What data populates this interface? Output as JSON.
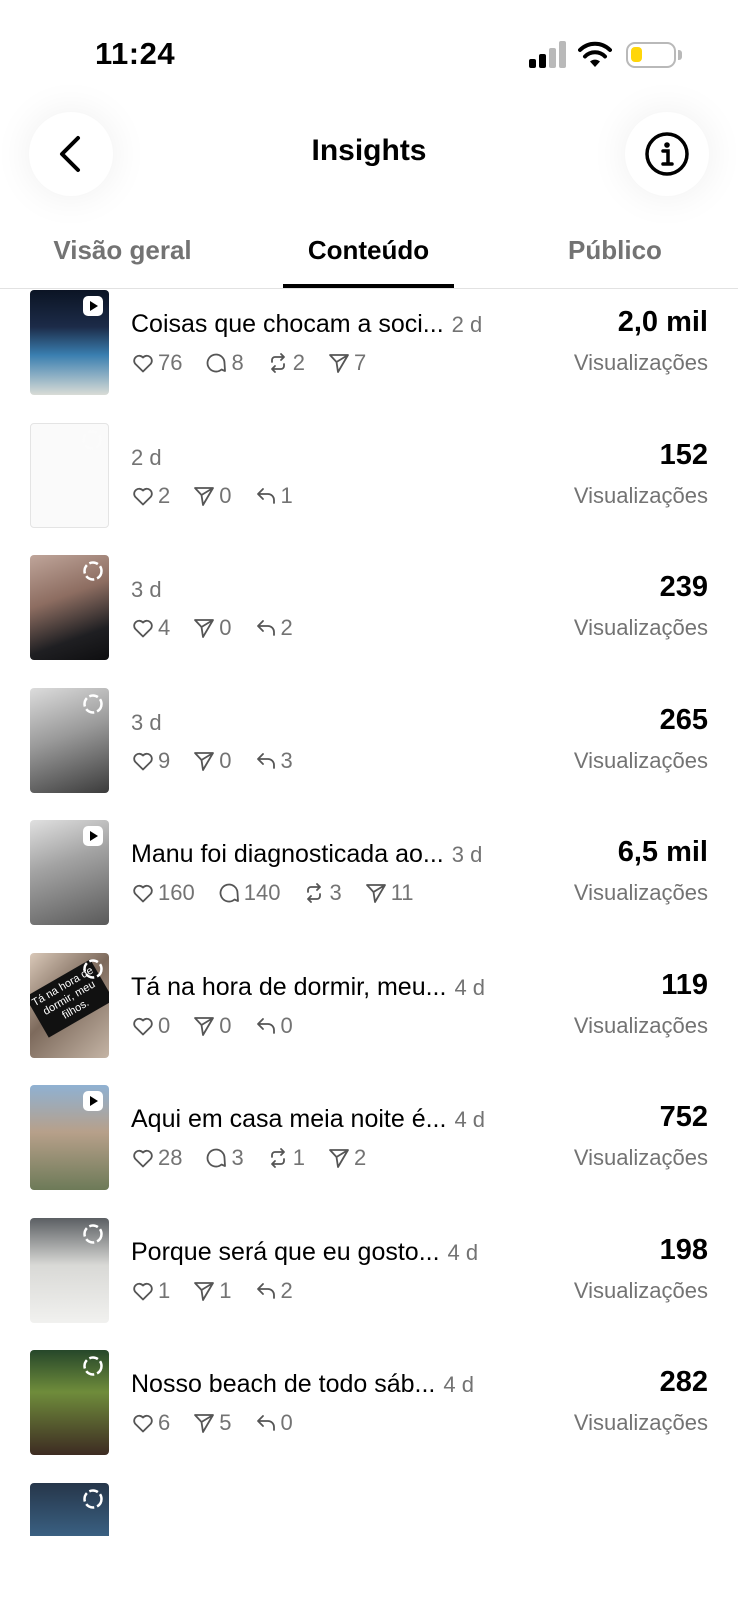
{
  "status": {
    "time": "11:24"
  },
  "header": {
    "title": "Insights"
  },
  "tabs": [
    {
      "label": "Visão geral",
      "active": false
    },
    {
      "label": "Conteúdo",
      "active": true
    },
    {
      "label": "Público",
      "active": false
    }
  ],
  "rows": [
    {
      "caption": "Coisas que chocam a soci...",
      "age": "2 d",
      "views": "2,0 mil",
      "views_label": "Visualizações",
      "badge": "video-icon",
      "stats": [
        {
          "icon": "heart-icon",
          "value": "76"
        },
        {
          "icon": "comment-icon",
          "value": "8"
        },
        {
          "icon": "repost-icon",
          "value": "2"
        },
        {
          "icon": "share-icon",
          "value": "7"
        }
      ]
    },
    {
      "caption": "",
      "age": "2 d",
      "views": "152",
      "views_label": "Visualizações",
      "badge": "story-icon",
      "stats": [
        {
          "icon": "heart-icon",
          "value": "2"
        },
        {
          "icon": "share-icon",
          "value": "0"
        },
        {
          "icon": "reply-icon",
          "value": "1"
        }
      ]
    },
    {
      "caption": "",
      "age": "3 d",
      "views": "239",
      "views_label": "Visualizações",
      "badge": "story-icon",
      "stats": [
        {
          "icon": "heart-icon",
          "value": "4"
        },
        {
          "icon": "share-icon",
          "value": "0"
        },
        {
          "icon": "reply-icon",
          "value": "2"
        }
      ]
    },
    {
      "caption": "",
      "age": "3 d",
      "views": "265",
      "views_label": "Visualizações",
      "badge": "story-icon",
      "stats": [
        {
          "icon": "heart-icon",
          "value": "9"
        },
        {
          "icon": "share-icon",
          "value": "0"
        },
        {
          "icon": "reply-icon",
          "value": "3"
        }
      ]
    },
    {
      "caption": "Manu foi diagnosticada ao...",
      "age": "3 d",
      "views": "6,5 mil",
      "views_label": "Visualizações",
      "badge": "video-icon",
      "stats": [
        {
          "icon": "heart-icon",
          "value": "160"
        },
        {
          "icon": "comment-icon",
          "value": "140"
        },
        {
          "icon": "repost-icon",
          "value": "3"
        },
        {
          "icon": "share-icon",
          "value": "11"
        }
      ]
    },
    {
      "caption": "Tá na hora de dormir, meu...",
      "age": "4 d",
      "views": "119",
      "views_label": "Visualizações",
      "badge": "story-icon",
      "thumb_text": "Tá na hora de dormir, meu filhos.",
      "stats": [
        {
          "icon": "heart-icon",
          "value": "0"
        },
        {
          "icon": "share-icon",
          "value": "0"
        },
        {
          "icon": "reply-icon",
          "value": "0"
        }
      ]
    },
    {
      "caption": "Aqui em casa meia noite é...",
      "age": "4 d",
      "views": "752",
      "views_label": "Visualizações",
      "badge": "video-icon",
      "stats": [
        {
          "icon": "heart-icon",
          "value": "28"
        },
        {
          "icon": "comment-icon",
          "value": "3"
        },
        {
          "icon": "repost-icon",
          "value": "1"
        },
        {
          "icon": "share-icon",
          "value": "2"
        }
      ]
    },
    {
      "caption": "Porque será que eu gosto...",
      "age": "4 d",
      "views": "198",
      "views_label": "Visualizações",
      "badge": "story-icon",
      "stats": [
        {
          "icon": "heart-icon",
          "value": "1"
        },
        {
          "icon": "share-icon",
          "value": "1"
        },
        {
          "icon": "reply-icon",
          "value": "2"
        }
      ]
    },
    {
      "caption": "Nosso beach de todo sáb...",
      "age": "4 d",
      "views": "282",
      "views_label": "Visualizações",
      "badge": "story-icon",
      "stats": [
        {
          "icon": "heart-icon",
          "value": "6"
        },
        {
          "icon": "share-icon",
          "value": "5"
        },
        {
          "icon": "reply-icon",
          "value": "0"
        }
      ]
    },
    {
      "caption": "",
      "age": "",
      "views": "",
      "views_label": "",
      "badge": "story-icon",
      "stats": []
    }
  ]
}
